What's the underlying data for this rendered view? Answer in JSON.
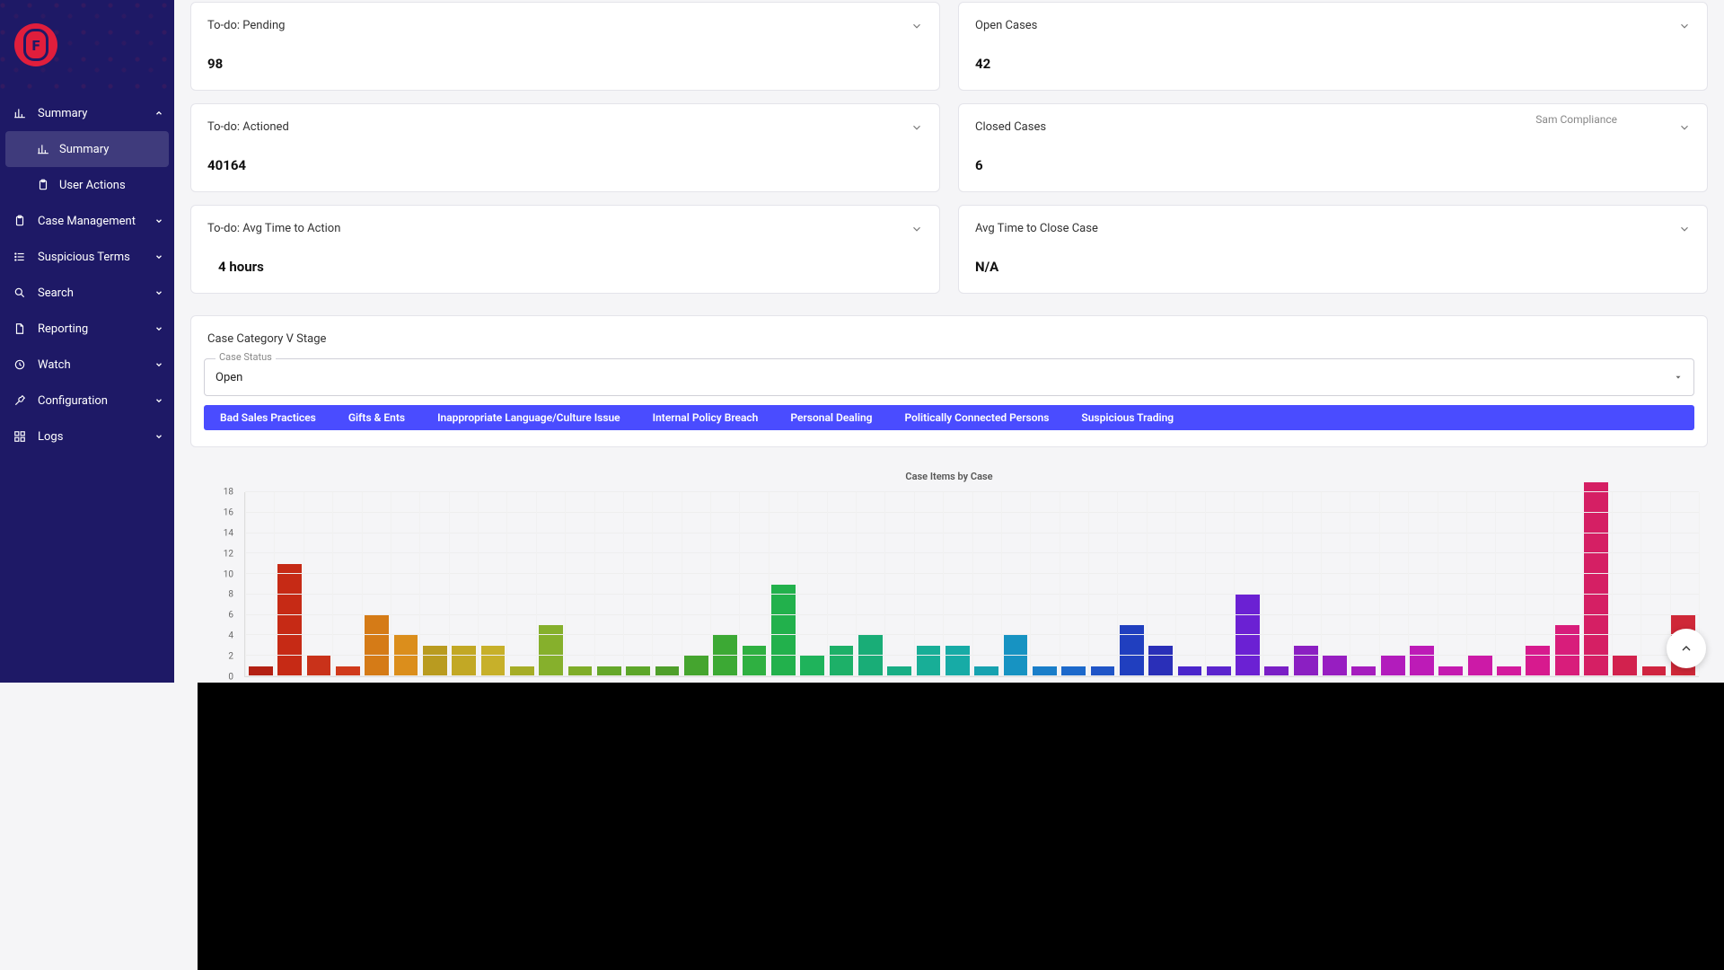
{
  "sidebar": {
    "logo_letter": "F",
    "items": [
      {
        "label": "Summary",
        "icon": "bar-chart",
        "children": [
          {
            "label": "Summary",
            "icon": "bar-chart",
            "active": true
          },
          {
            "label": "User Actions",
            "icon": "clipboard"
          }
        ],
        "expanded": true
      },
      {
        "label": "Case Management",
        "icon": "clipboard"
      },
      {
        "label": "Suspicious Terms",
        "icon": "list"
      },
      {
        "label": "Search",
        "icon": "search"
      },
      {
        "label": "Reporting",
        "icon": "file"
      },
      {
        "label": "Watch",
        "icon": "clock"
      },
      {
        "label": "Configuration",
        "icon": "wrench"
      },
      {
        "label": "Logs",
        "icon": "grid"
      }
    ]
  },
  "cards": {
    "r1c1": {
      "title": "To-do: Pending",
      "value": "98"
    },
    "r1c2": {
      "title": "Open Cases",
      "value": "42"
    },
    "r2c1": {
      "title": "To-do: Actioned",
      "value": "40164"
    },
    "r2c2": {
      "title": "Closed Cases",
      "value": "6",
      "user": "Sam Compliance"
    },
    "r3c1": {
      "title": "To-do: Avg Time to Action",
      "value": "4 hours"
    },
    "r3c2": {
      "title": "Avg Time to Close Case",
      "value": "N/A"
    }
  },
  "panel": {
    "title": "Case Category V Stage",
    "select_label": "Case Status",
    "select_value": "Open",
    "tabs": [
      "Bad Sales Practices",
      "Gifts & Ents",
      "Inappropriate Language/Culture Issue",
      "Internal Policy Breach",
      "Personal Dealing",
      "Politically Connected Persons",
      "Suspicious Trading"
    ]
  },
  "chart_data": {
    "type": "bar",
    "title": "Case Items by Case",
    "xlabel": "",
    "ylabel": "",
    "ylim": [
      0,
      18
    ],
    "y_ticks": [
      0,
      2,
      4,
      6,
      8,
      10,
      12,
      14,
      16,
      18
    ],
    "values": [
      1,
      11,
      2,
      1,
      6,
      4,
      3,
      3,
      3,
      1,
      5,
      1,
      1,
      1,
      1,
      2,
      4,
      3,
      9,
      2,
      3,
      4,
      1,
      3,
      3,
      1,
      4,
      1,
      1,
      1,
      5,
      3,
      1,
      1,
      8,
      1,
      3,
      2,
      1,
      2,
      3,
      1,
      2,
      1,
      3,
      5,
      19,
      2,
      1,
      6
    ],
    "colors": [
      "#b32013",
      "#c62a15",
      "#c9321a",
      "#d03a1c",
      "#d57b17",
      "#db8e1c",
      "#b99b20",
      "#c2a825",
      "#c7b02a",
      "#a6ad27",
      "#86b02c",
      "#7fad29",
      "#65a72a",
      "#5da62a",
      "#4f9f2b",
      "#45a52f",
      "#3ca934",
      "#2fb041",
      "#22b14c",
      "#1fb35b",
      "#1db068",
      "#19ad77",
      "#18ae85",
      "#18ae97",
      "#17aba6",
      "#17a2b0",
      "#1793c2",
      "#1a7ec9",
      "#1d69cb",
      "#2055c7",
      "#203fbf",
      "#2a2fb8",
      "#4a25cb",
      "#5b24ce",
      "#6b21d3",
      "#7a1fc6",
      "#8b1fc2",
      "#971ec1",
      "#a51dbe",
      "#b21cbc",
      "#bd1bb7",
      "#c41ab0",
      "#cc1aa7",
      "#d31a9d",
      "#d71a8e",
      "#d81d7b",
      "#d51f64",
      "#d2224e",
      "#d02440",
      "#cf2838"
    ]
  }
}
